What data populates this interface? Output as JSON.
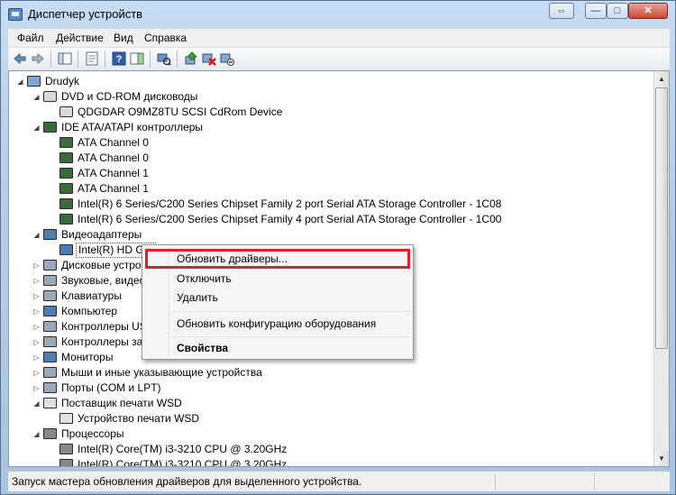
{
  "window": {
    "title": "Диспетчер устройств"
  },
  "titlebar_buttons": {
    "swap": "⇔",
    "minimize": "—",
    "maximize": "□",
    "close": "✕"
  },
  "menu": [
    "Файл",
    "Действие",
    "Вид",
    "Справка"
  ],
  "tree": {
    "root": "Drudyk",
    "items": [
      "DVD и CD-ROM дисководы",
      "QDGDAR O9MZ8TU SCSI CdRom Device",
      "IDE ATA/ATAPI контроллеры",
      "ATA Channel 0",
      "ATA Channel 0",
      "ATA Channel 1",
      "ATA Channel 1",
      "Intel(R) 6 Series/C200 Series Chipset Family 2 port Serial ATA Storage Controller - 1C08",
      "Intel(R) 6 Series/C200 Series Chipset Family 4 port Serial ATA Storage Controller - 1C00",
      "Видеоадаптеры",
      "Intel(R) HD Gra",
      "Дисковые устрой",
      "Звуковые, видео и",
      "Клавиатуры",
      "Компьютер",
      "Контроллеры USB",
      "Контроллеры зап",
      "Мониторы",
      "Мыши и иные указывающие устройства",
      "Порты (COM и LPT)",
      "Поставщик печати WSD",
      "Устройство печати WSD",
      "Процессоры",
      "Intel(R) Core(TM) i3-3210 CPU @ 3.20GHz",
      "Intel(R) Core(TM) i3-3210 CPU @ 3.20GHz"
    ]
  },
  "context_menu": {
    "update_drivers": "Обновить драйверы...",
    "disable": "Отключить",
    "uninstall": "Удалить",
    "scan_hardware": "Обновить конфигурацию оборудования",
    "properties": "Свойства"
  },
  "status": {
    "text": "Запуск мастера обновления драйверов для выделенного устройства."
  },
  "colors": {
    "highlight_border": "#e0202a",
    "window_frame": "#b4cde9"
  }
}
